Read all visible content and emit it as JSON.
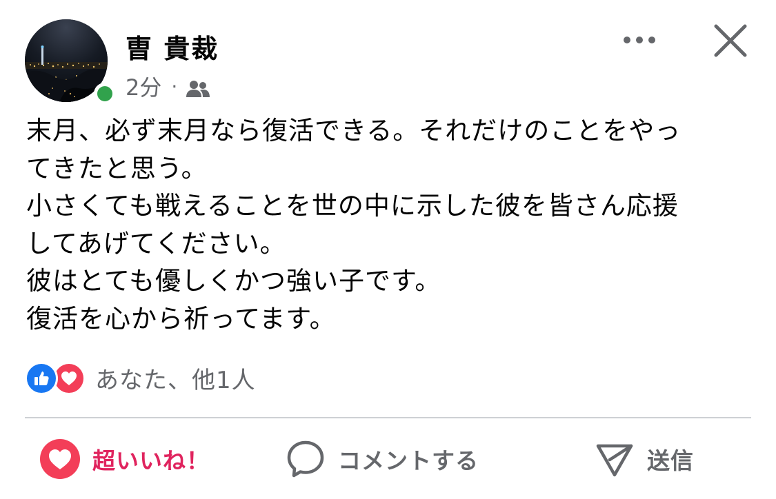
{
  "post": {
    "author": "曺 貴裁",
    "time": "2分",
    "separator": "·",
    "audience_icon": "friends-icon",
    "text_lines": [
      "末月、必ず末月なら復活できる。それだけのことをやっ",
      "てきたと思う。",
      "小さくても戦えることを世の中に示した彼を皆さん応援",
      "してあげてください。",
      "彼はとても優しくかつ強い子です。",
      "復活を心から祈ってます。"
    ]
  },
  "reactions": {
    "icons": [
      "like-icon",
      "love-icon"
    ],
    "summary": "あなた、他1人"
  },
  "actions": {
    "love_label": "超いいね！",
    "comment_label": "コメントする",
    "send_label": "送信"
  },
  "colors": {
    "online": "#31a24c",
    "like": "#1877f2",
    "love": "#f33e58",
    "active_reaction_text": "#e0245e",
    "secondary_text": "#65676b",
    "primary_text": "#050505",
    "divider": "#ced0d4"
  }
}
